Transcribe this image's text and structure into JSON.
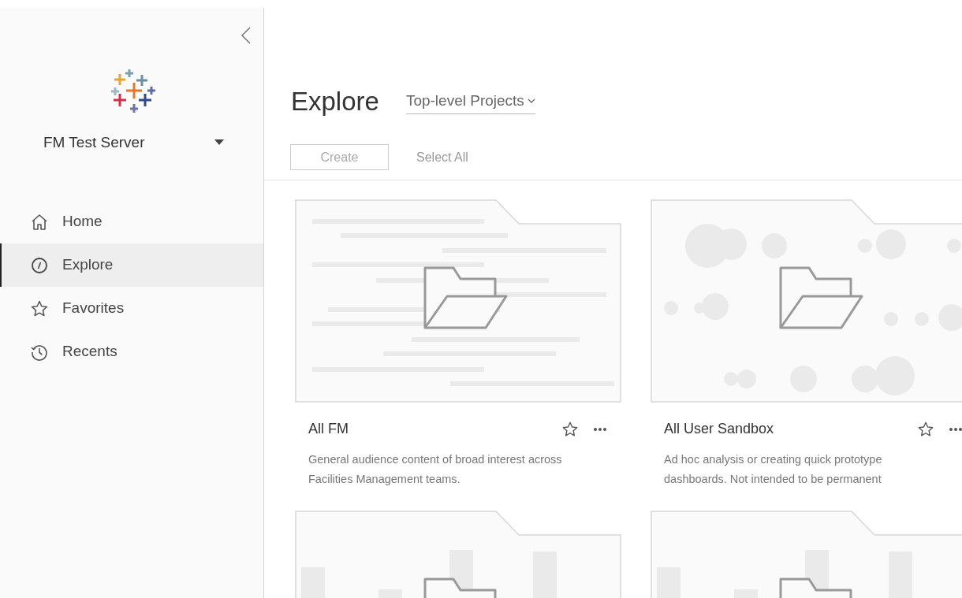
{
  "sidebar": {
    "server": "FM Test Server",
    "nav": [
      {
        "label": "Home",
        "selected": false
      },
      {
        "label": "Explore",
        "selected": true
      },
      {
        "label": "Favorites",
        "selected": false
      },
      {
        "label": "Recents",
        "selected": false
      }
    ]
  },
  "header": {
    "title": "Explore",
    "filter": "Top-level Projects"
  },
  "toolbar": {
    "create": {
      "label": "Create",
      "disabled": true
    },
    "select_all": "Select All"
  },
  "projects": [
    {
      "kind": "lines",
      "name": "All FM",
      "description": "General audience content of broad interest across Facilities Management teams."
    },
    {
      "kind": "bubbles",
      "name": "All User Sandbox",
      "description": "Ad hoc analysis or creating quick prototype dashboards. Not intended to be permanent"
    },
    {
      "kind": "bars"
    },
    {
      "kind": "bars"
    }
  ]
}
